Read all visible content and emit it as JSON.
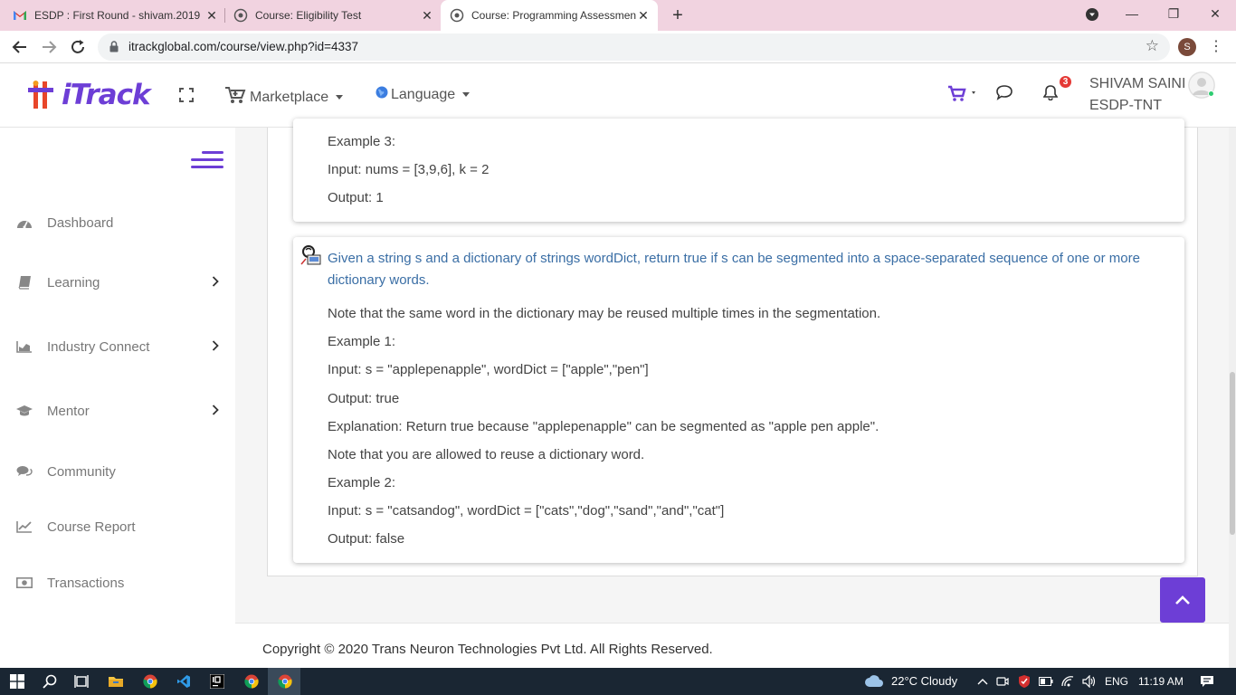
{
  "browser": {
    "tabs": [
      {
        "title": "ESDP : First Round - shivam.2019",
        "icon": "gmail-icon"
      },
      {
        "title": "Course: Eligibility Test",
        "icon": "site-icon"
      },
      {
        "title": "Course: Programming Assessmen",
        "icon": "site-icon"
      }
    ],
    "close_glyph": "✕",
    "new_tab_glyph": "+",
    "url": "itrackglobal.com/course/view.php?id=4337",
    "profile_initial": "S",
    "window_controls": {
      "minimize": "—",
      "maximize": "❐",
      "close": "✕"
    }
  },
  "header": {
    "logo_text": "iTrack",
    "nav": [
      {
        "label": "Marketplace",
        "icon": "cart-icon"
      },
      {
        "label": "Language",
        "icon": "globe-icon"
      }
    ],
    "notification_count": "3",
    "user_name": "SHIVAM SAINI",
    "user_org": "ESDP-TNT",
    "brand_color": "#6d3ed6"
  },
  "sidebar": {
    "items": [
      {
        "label": "Dashboard",
        "icon": "dashboard-icon",
        "has_submenu": false
      },
      {
        "label": "Learning",
        "icon": "book-icon",
        "has_submenu": true
      },
      {
        "label": "Industry Connect",
        "icon": "chart-icon",
        "has_submenu": true
      },
      {
        "label": "Mentor",
        "icon": "graduation-cap-icon",
        "has_submenu": true
      },
      {
        "label": "Community",
        "icon": "comments-icon",
        "has_submenu": false
      },
      {
        "label": "Course Report",
        "icon": "line-chart-icon",
        "has_submenu": false
      },
      {
        "label": "Transactions",
        "icon": "money-icon",
        "has_submenu": false
      }
    ],
    "chevron": "›"
  },
  "content": {
    "card1": {
      "lines": [
        "Example 3:",
        "Input: nums = [3,9,6], k = 2",
        "Output: 1"
      ]
    },
    "card2": {
      "question": "Given a string s and a dictionary of strings wordDict, return true if s can be segmented into a space-separated sequence of one or more dictionary words.",
      "lines": [
        "Note that the same word in the dictionary may be reused multiple times in the segmentation.",
        "Example 1:",
        "Input: s = \"applepenapple\", wordDict = [\"apple\",\"pen\"]",
        "Output: true",
        "Explanation: Return true because \"applepenapple\" can be segmented as \"apple pen apple\".",
        "Note that you are allowed to reuse a dictionary word.",
        "Example 2:",
        "Input: s = \"catsandog\", wordDict = [\"cats\",\"dog\",\"sand\",\"and\",\"cat\"]",
        "Output: false"
      ]
    }
  },
  "footer": {
    "copyright": "Copyright © 2020 Trans Neuron Technologies Pvt Ltd. All Rights Reserved."
  },
  "taskbar": {
    "weather": "22°C  Cloudy",
    "language": "ENG",
    "time": "11:19 AM"
  }
}
